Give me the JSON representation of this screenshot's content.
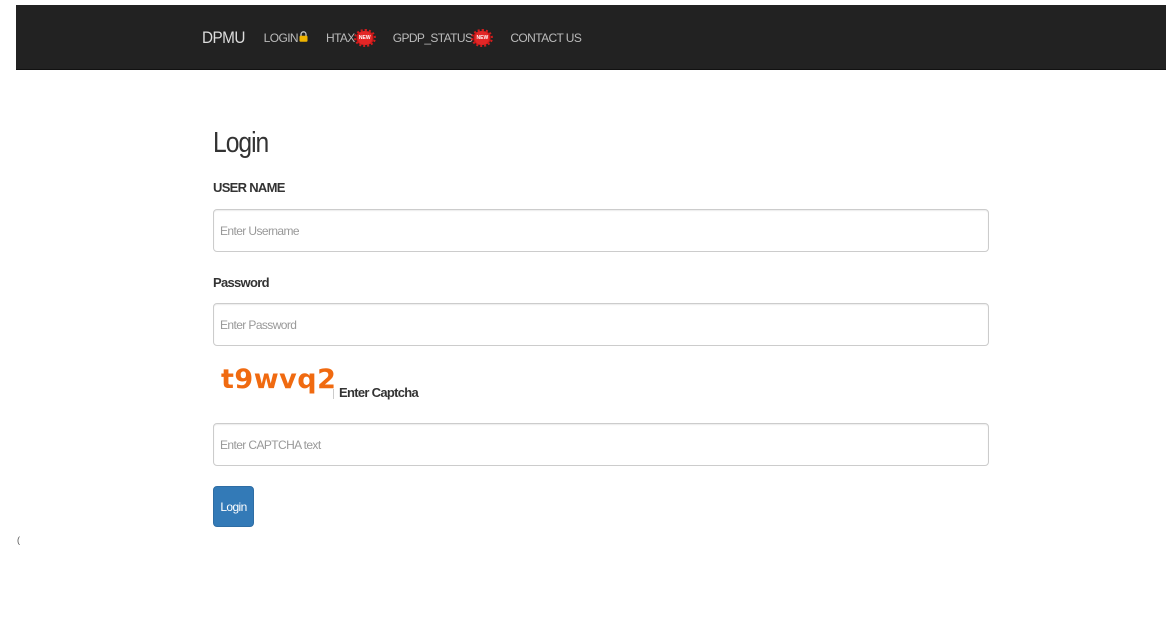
{
  "navbar": {
    "brand": "DPMU",
    "items": [
      {
        "label": "LOGIN",
        "icon": "lock-icon"
      },
      {
        "label": "HTAX",
        "icon": "new-badge-icon"
      },
      {
        "label": "GPDP_STATUS",
        "icon": "new-badge-icon"
      },
      {
        "label": "CONTACT US",
        "icon": null
      }
    ],
    "badge_text": "NEW",
    "colors": {
      "background": "#222222",
      "text": "#bbbbbb"
    }
  },
  "form": {
    "title": "Login",
    "username": {
      "label": "USER NAME",
      "placeholder": "Enter Username",
      "value": ""
    },
    "password": {
      "label": "Password",
      "placeholder": "Enter Password",
      "value": ""
    },
    "captcha": {
      "code": "t9wvq2",
      "label": "Enter Captcha",
      "placeholder": "Enter CAPTCHA text",
      "value": "",
      "color": "#f06a10"
    },
    "submit_label": "Login",
    "submit_color": "#337ab7"
  },
  "stray_mark": "("
}
